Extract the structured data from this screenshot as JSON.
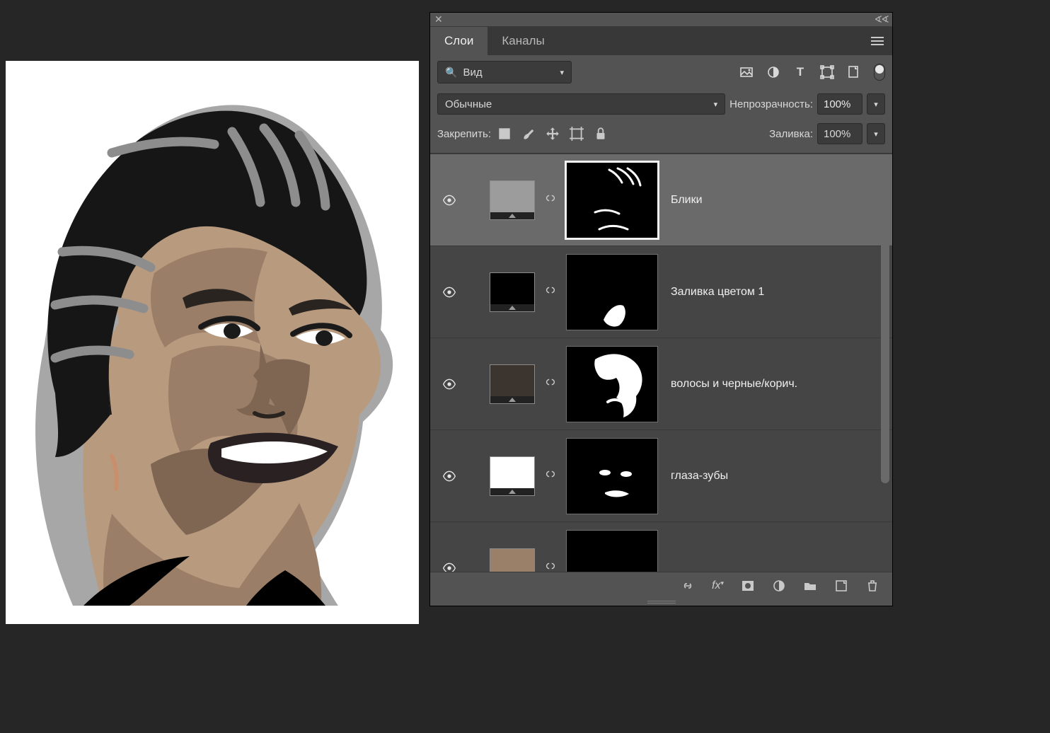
{
  "panel": {
    "tabs": {
      "layers": "Слои",
      "channels": "Каналы"
    },
    "search_label": "Вид",
    "blend_mode": "Обычные",
    "opacity_label": "Непрозрачность:",
    "opacity_value": "100%",
    "lock_label": "Закрепить:",
    "fill_label": "Заливка:",
    "fill_value": "100%"
  },
  "layers": [
    {
      "name": "Блики",
      "swatch": "#9c9c9c",
      "selected": true,
      "mask_variant": 0
    },
    {
      "name": "Заливка цветом 1",
      "swatch": "#000000",
      "selected": false,
      "mask_variant": 1
    },
    {
      "name": "волосы и черные/корич.",
      "swatch": "#3b342f",
      "selected": false,
      "mask_variant": 2
    },
    {
      "name": "глаза-зубы",
      "swatch": "#ffffff",
      "selected": false,
      "mask_variant": 3
    },
    {
      "name": "",
      "swatch": "#9b8069",
      "selected": false,
      "mask_variant": 4
    }
  ],
  "colors": {
    "skin_light": "#b89a7f",
    "skin_mid": "#9a7e67",
    "skin_dark": "#7e6653",
    "hair": "#161616",
    "hair_hl": "#8d8d8d",
    "lips": "#2a2122",
    "white": "#ffffff",
    "brow": "#2a2420"
  }
}
